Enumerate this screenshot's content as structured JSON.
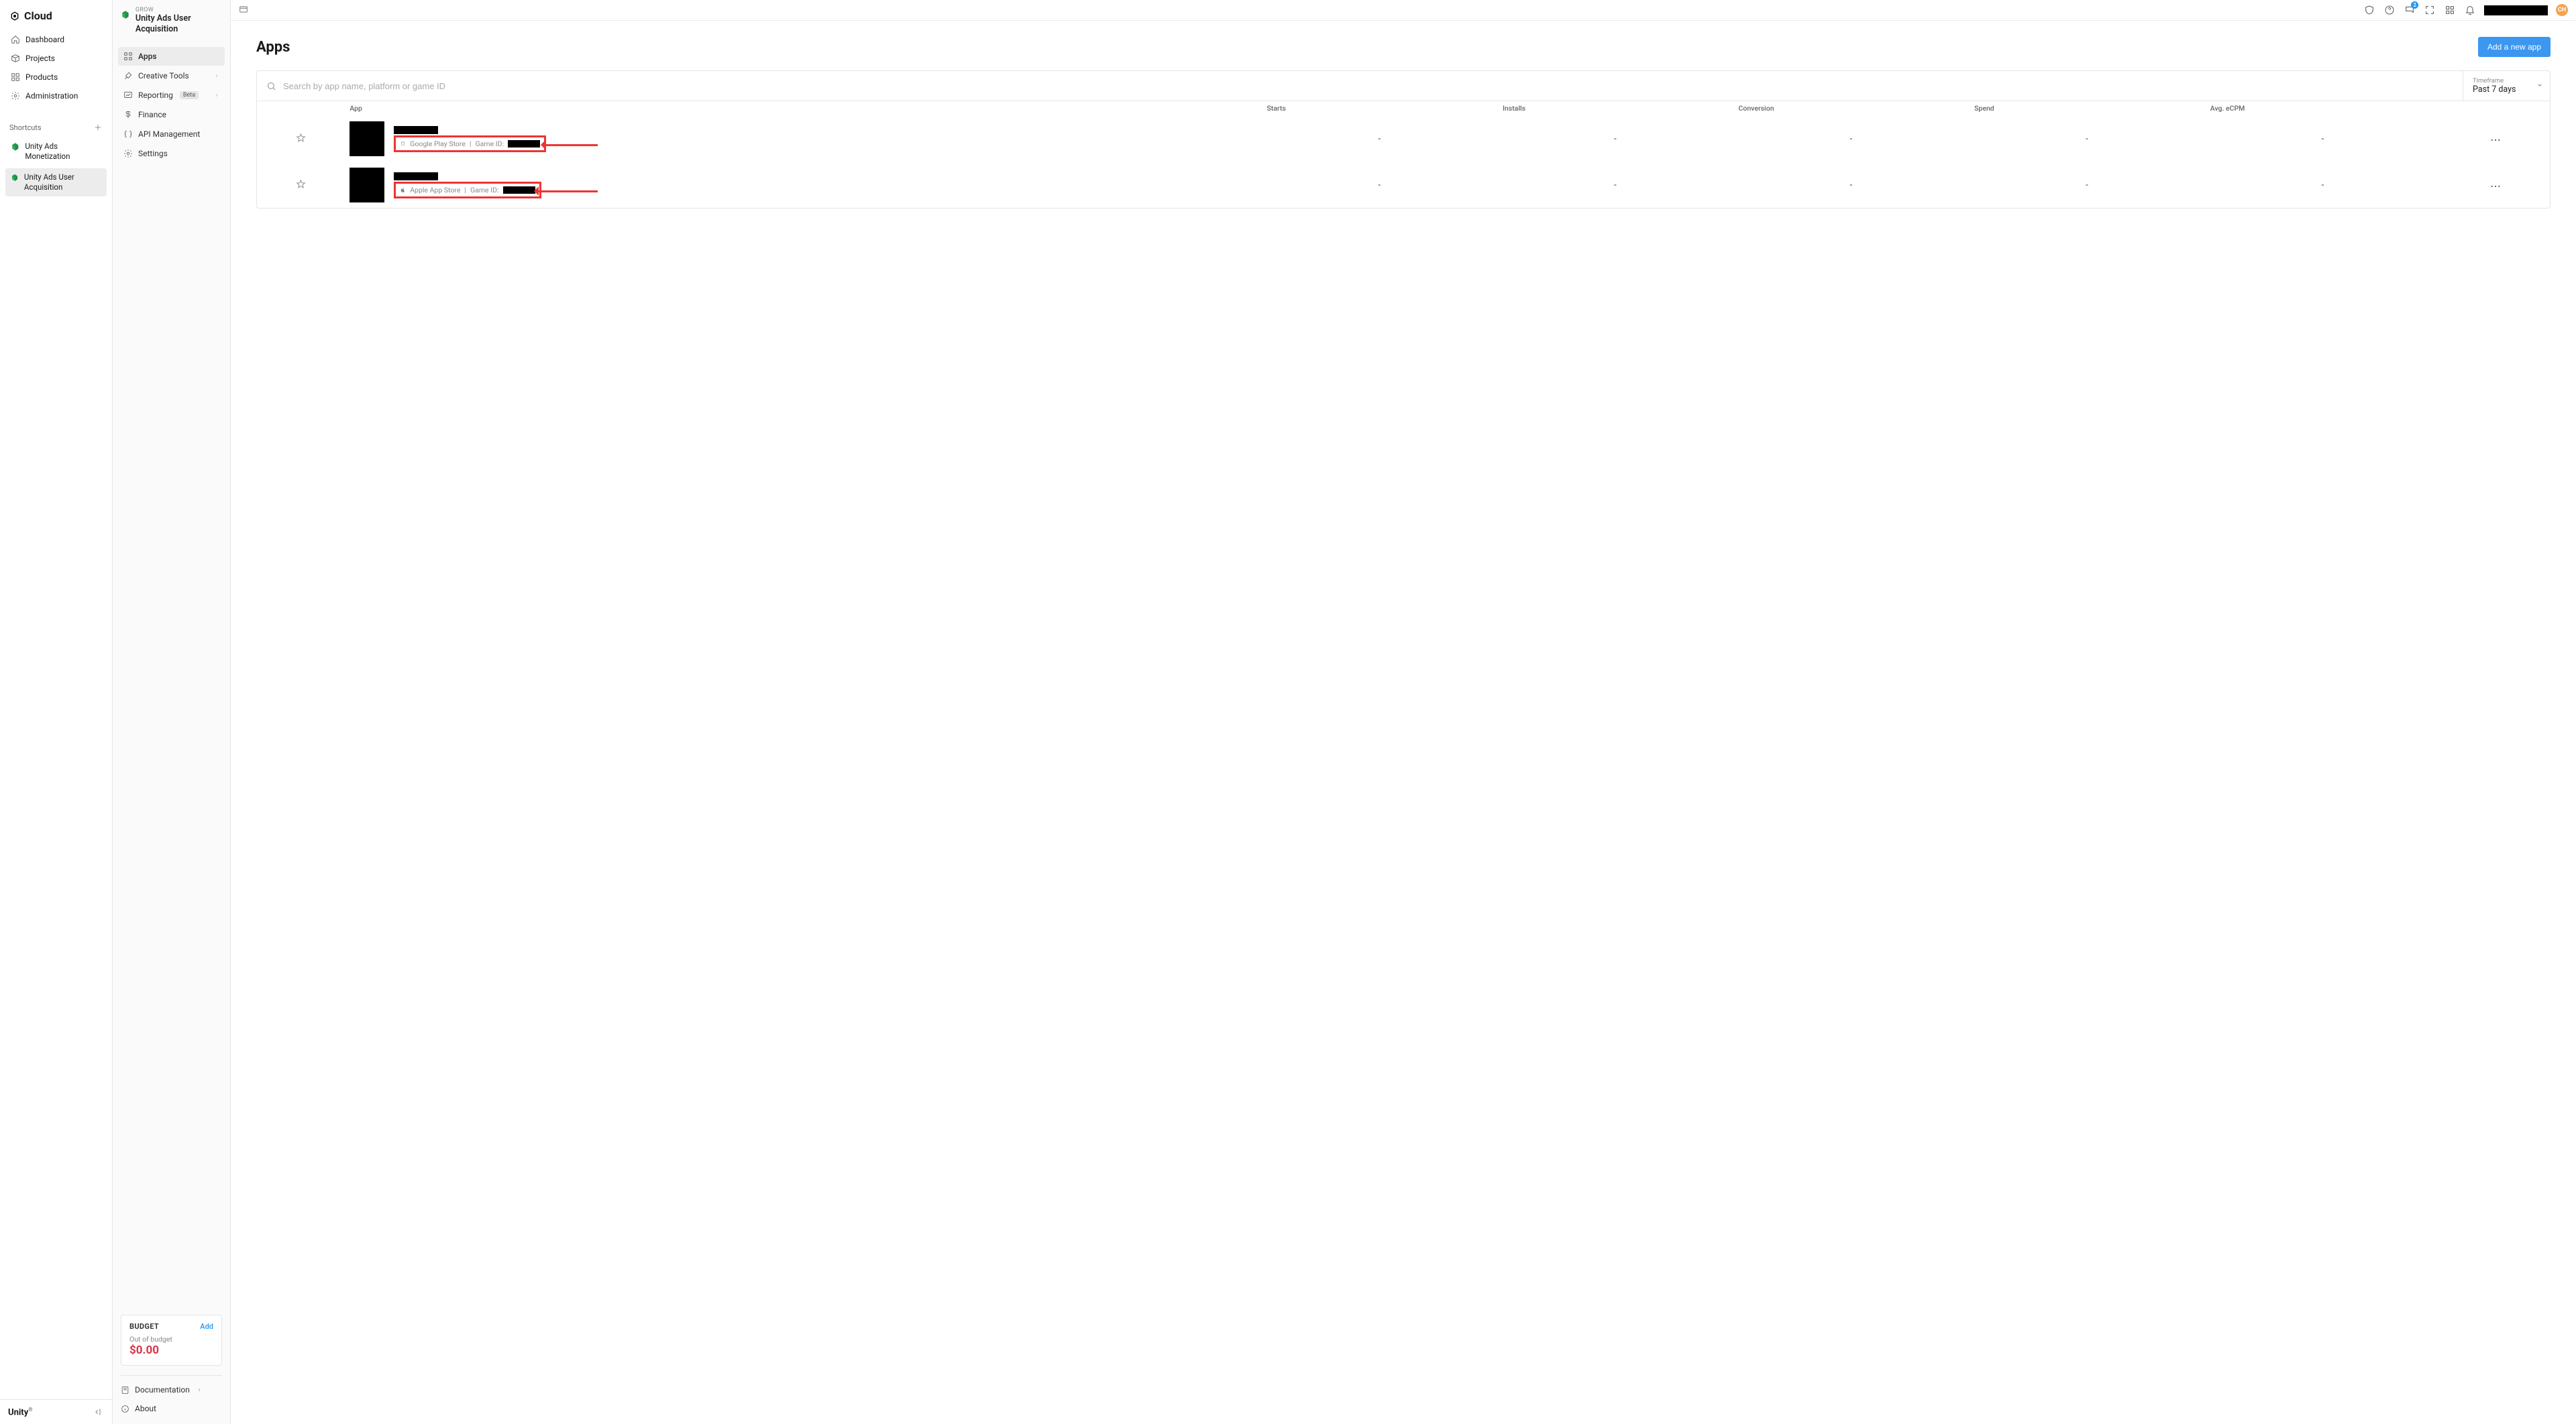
{
  "brand": "Cloud",
  "leftNav": {
    "items": [
      {
        "label": "Dashboard"
      },
      {
        "label": "Projects"
      },
      {
        "label": "Products"
      },
      {
        "label": "Administration"
      }
    ],
    "shortcutsLabel": "Shortcuts",
    "shortcuts": [
      {
        "label": "Unity Ads Monetization"
      },
      {
        "label": "Unity Ads User Acquisition"
      }
    ],
    "footerWordmark": "Unity"
  },
  "midNav": {
    "eyebrow": "GROW",
    "title": "Unity Ads User Acquisition",
    "items": [
      {
        "label": "Apps",
        "active": true,
        "hasSub": false
      },
      {
        "label": "Creative Tools",
        "hasSub": true
      },
      {
        "label": "Reporting",
        "badge": "Beta",
        "hasSub": true
      },
      {
        "label": "Finance",
        "hasSub": false
      },
      {
        "label": "API Management",
        "hasSub": false
      },
      {
        "label": "Settings",
        "hasSub": false
      }
    ],
    "budget": {
      "title": "BUDGET",
      "addLabel": "Add",
      "status": "Out of budget",
      "amount": "$0.00"
    },
    "footer": [
      {
        "label": "Documentation",
        "hasSub": true
      },
      {
        "label": "About"
      }
    ]
  },
  "topBar": {
    "notificationCount": "2",
    "avatar": "CH"
  },
  "page": {
    "title": "Apps",
    "primaryButton": "Add a new app",
    "searchPlaceholder": "Search by app name, platform or game ID",
    "timeframeLabel": "Timeframe",
    "timeframeValue": "Past 7 days",
    "columns": {
      "app": "App",
      "starts": "Starts",
      "installs": "Installs",
      "conversion": "Conversion",
      "spend": "Spend",
      "ecpm": "Avg. eCPM"
    },
    "rows": [
      {
        "store": "Google Play Store",
        "gameIdPrefix": "Game ID:",
        "starts": "-",
        "installs": "-",
        "conversion": "-",
        "spend": "-",
        "ecpm": "-"
      },
      {
        "store": "Apple App Store",
        "gameIdPrefix": "Game ID:",
        "starts": "-",
        "installs": "-",
        "conversion": "-",
        "spend": "-",
        "ecpm": "-"
      }
    ]
  }
}
